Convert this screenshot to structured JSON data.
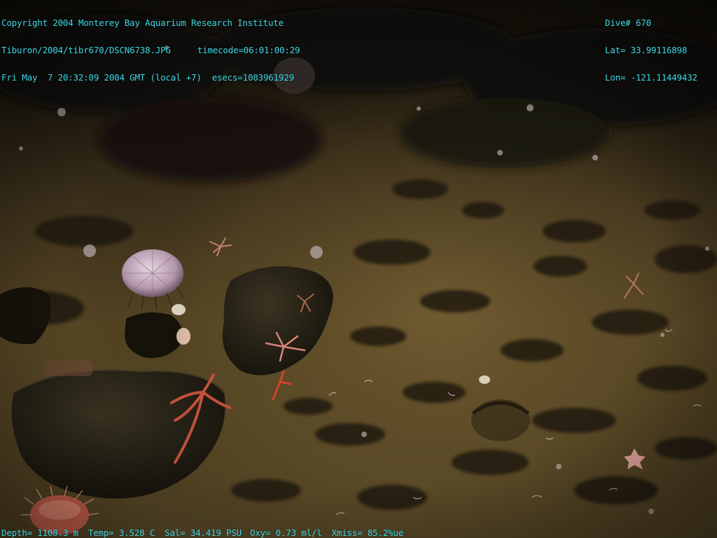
{
  "overlay": {
    "header_left": {
      "line1": "Copyright 2004 Monterey Bay Aquarium Research Institute",
      "line2_path": "Tiburon/2004/tibr670/DSCN6738.JPG",
      "line2_timecode": "timecode=06:01:00:29",
      "line3_datetime": "Fri May  7 20:32:09 2004 GMT (local +7)",
      "line3_esecs": "esecs=1083961929"
    },
    "header_right": {
      "dive": "Dive# 670",
      "lat": "Lat= 33.99116898",
      "lon": "Lon= -121.11449432"
    },
    "footer": {
      "depth": "Depth= 1108.3 m",
      "temp": "Temp= 3.528 C",
      "sal": "Sal= 34.419 PSU",
      "oxy": "Oxy= 0.73 ml/l",
      "xmiss": "Xmiss= 85.2%ue"
    }
  },
  "colors": {
    "overlay_text": "#3fd7e6",
    "sediment_light": "#6e5a32",
    "sediment_dark": "#1b170f",
    "urchin": "#c9b3c4",
    "brittle_star": "#d06a55",
    "anemone": "#e0735f"
  }
}
